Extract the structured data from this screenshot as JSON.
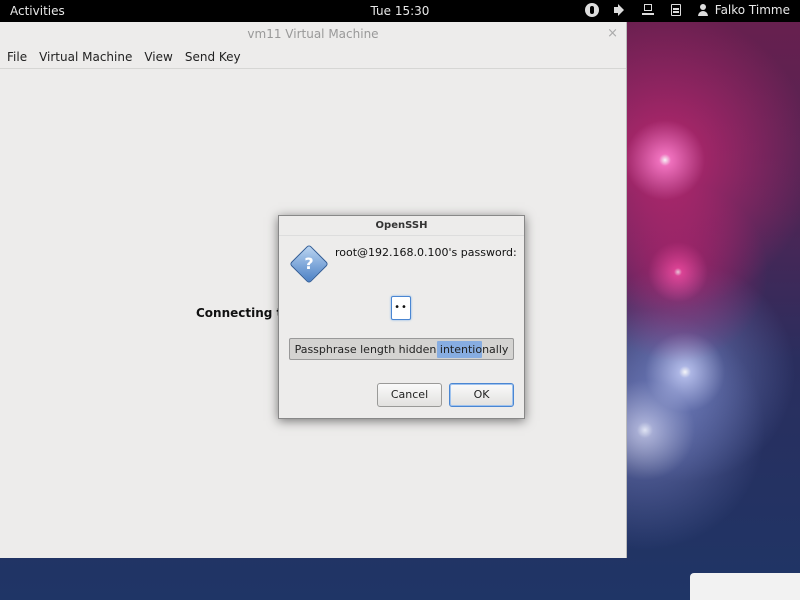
{
  "topbar": {
    "activities": "Activities",
    "clock": "Tue 15:30",
    "user": "Falko Timme",
    "tray_icons": [
      "accessibility-icon",
      "volume-icon",
      "network-icon",
      "clipboard-icon"
    ]
  },
  "vm_window": {
    "title": "vm11 Virtual Machine",
    "close_glyph": "×",
    "menu": [
      "File",
      "Virtual Machine",
      "View",
      "Send Key"
    ],
    "status_text": "Connecting to"
  },
  "dialog": {
    "title": "OpenSSH",
    "icon": "question-icon",
    "prompt": "root@192.168.0.100's password:",
    "password_mask": "••",
    "hint": "Passphrase length hidden intentionally",
    "cancel_label": "Cancel",
    "ok_label": "OK"
  }
}
